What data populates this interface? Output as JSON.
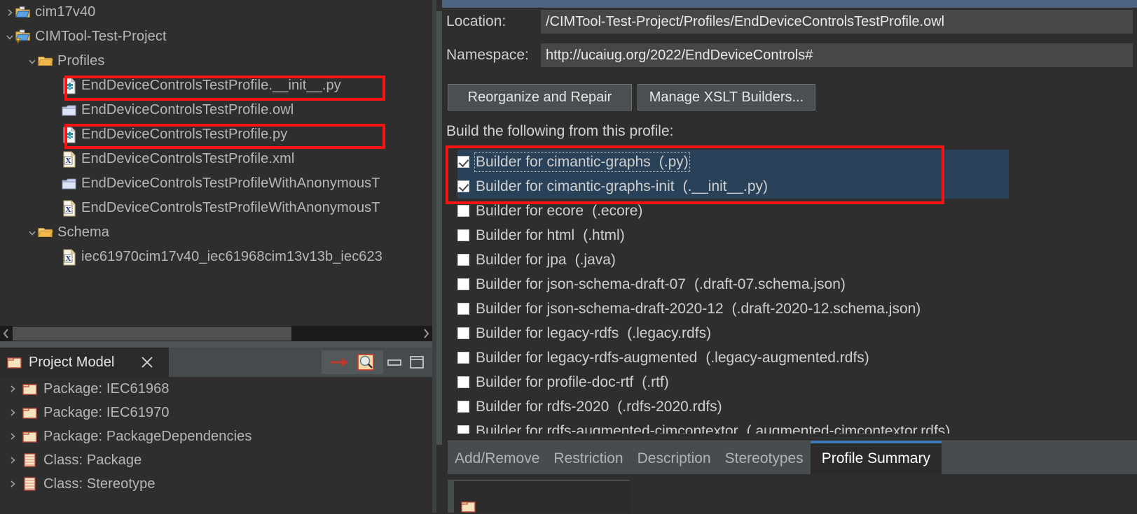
{
  "tree": {
    "items": [
      {
        "label": "cim17v40",
        "icon": "project-folder-icon",
        "twist": "collapsed",
        "indent": 0
      },
      {
        "label": "CIMTool-Test-Project",
        "icon": "project-folder-warning-icon",
        "twist": "expanded",
        "indent": 0
      },
      {
        "label": "Profiles",
        "icon": "folder-open-icon",
        "twist": "expanded",
        "indent": 1
      },
      {
        "label": "EndDeviceControlsTestProfile.__init__.py",
        "icon": "python-file-icon",
        "twist": "none",
        "indent": 2,
        "highlight": true
      },
      {
        "label": "EndDeviceControlsTestProfile.owl",
        "icon": "owl-file-icon",
        "twist": "none",
        "indent": 2
      },
      {
        "label": "EndDeviceControlsTestProfile.py",
        "icon": "python-file-icon",
        "twist": "none",
        "indent": 2,
        "highlight": true
      },
      {
        "label": "EndDeviceControlsTestProfile.xml",
        "icon": "xml-file-icon",
        "twist": "none",
        "indent": 2
      },
      {
        "label": "EndDeviceControlsTestProfileWithAnonymousT",
        "icon": "owl-file-icon",
        "twist": "none",
        "indent": 2
      },
      {
        "label": "EndDeviceControlsTestProfileWithAnonymousT",
        "icon": "xml-file-icon",
        "twist": "none",
        "indent": 2
      },
      {
        "label": "Schema",
        "icon": "folder-open-icon",
        "twist": "expanded",
        "indent": 1
      },
      {
        "label": "iec61970cim17v40_iec61968cim13v13b_iec623",
        "icon": "xml-file-icon",
        "twist": "none",
        "indent": 2
      }
    ]
  },
  "project_model": {
    "tab_label": "Project Model",
    "close_icon": "close-icon",
    "toolbar": [
      {
        "icon": "red-arrow-icon"
      },
      {
        "icon": "search-magnifier-icon"
      },
      {
        "icon": "minimize-icon"
      },
      {
        "icon": "maximize-icon"
      }
    ],
    "items": [
      {
        "label": "Package: IEC61968",
        "icon": "package-folder-icon"
      },
      {
        "label": "Package: IEC61970",
        "icon": "package-folder-icon"
      },
      {
        "label": "Package: PackageDependencies",
        "icon": "package-folder-icon"
      },
      {
        "label": "Class: Package",
        "icon": "class-icon"
      },
      {
        "label": "Class: Stereotype",
        "icon": "class-icon"
      }
    ]
  },
  "profile_summary": {
    "location_label": "Location:",
    "location_value": "/CIMTool-Test-Project/Profiles/EndDeviceControlsTestProfile.owl",
    "namespace_label": "Namespace:",
    "namespace_value": "http://ucaiug.org/2022/EndDeviceControls#",
    "reorganize_button": "Reorganize and Repair",
    "manage_xslt_button": "Manage XSLT Builders...",
    "build_label": "Build the following from this profile:",
    "builders": [
      {
        "name": "Builder for cimantic-graphs",
        "ext": "(.py)",
        "checked": true,
        "selected": true,
        "focused": true
      },
      {
        "name": "Builder for cimantic-graphs-init",
        "ext": "(.__init__.py)",
        "checked": true,
        "selected": true,
        "focused": false
      },
      {
        "name": "Builder for ecore",
        "ext": "(.ecore)",
        "checked": false,
        "selected": false,
        "focused": false
      },
      {
        "name": "Builder for html",
        "ext": "(.html)",
        "checked": false,
        "selected": false,
        "focused": false
      },
      {
        "name": "Builder for jpa",
        "ext": "(.java)",
        "checked": false,
        "selected": false,
        "focused": false
      },
      {
        "name": "Builder for json-schema-draft-07",
        "ext": "(.draft-07.schema.json)",
        "checked": false,
        "selected": false,
        "focused": false
      },
      {
        "name": "Builder for json-schema-draft-2020-12",
        "ext": "(.draft-2020-12.schema.json)",
        "checked": false,
        "selected": false,
        "focused": false
      },
      {
        "name": "Builder for legacy-rdfs",
        "ext": "(.legacy.rdfs)",
        "checked": false,
        "selected": false,
        "focused": false
      },
      {
        "name": "Builder for legacy-rdfs-augmented",
        "ext": "(.legacy-augmented.rdfs)",
        "checked": false,
        "selected": false,
        "focused": false
      },
      {
        "name": "Builder for profile-doc-rtf",
        "ext": "(.rtf)",
        "checked": false,
        "selected": false,
        "focused": false
      },
      {
        "name": "Builder for rdfs-2020",
        "ext": "(.rdfs-2020.rdfs)",
        "checked": false,
        "selected": false,
        "focused": false
      },
      {
        "name": "Builder for rdfs-augmented-cimcontextor",
        "ext": "(.augmented-cimcontextor.rdfs)",
        "checked": false,
        "selected": false,
        "focused": false
      }
    ],
    "tabs": [
      {
        "label": "Add/Remove",
        "active": false
      },
      {
        "label": "Restriction",
        "active": false
      },
      {
        "label": "Description",
        "active": false
      },
      {
        "label": "Stereotypes",
        "active": false
      },
      {
        "label": "Profile Summary",
        "active": true
      }
    ]
  },
  "colors": {
    "background": "#2e2e2e",
    "selection": "#2a4259",
    "annotation_red": "#f81414",
    "tab_accent": "#3d7ab5",
    "top_bar": "#4c6480",
    "text": "#cfcfcf"
  }
}
